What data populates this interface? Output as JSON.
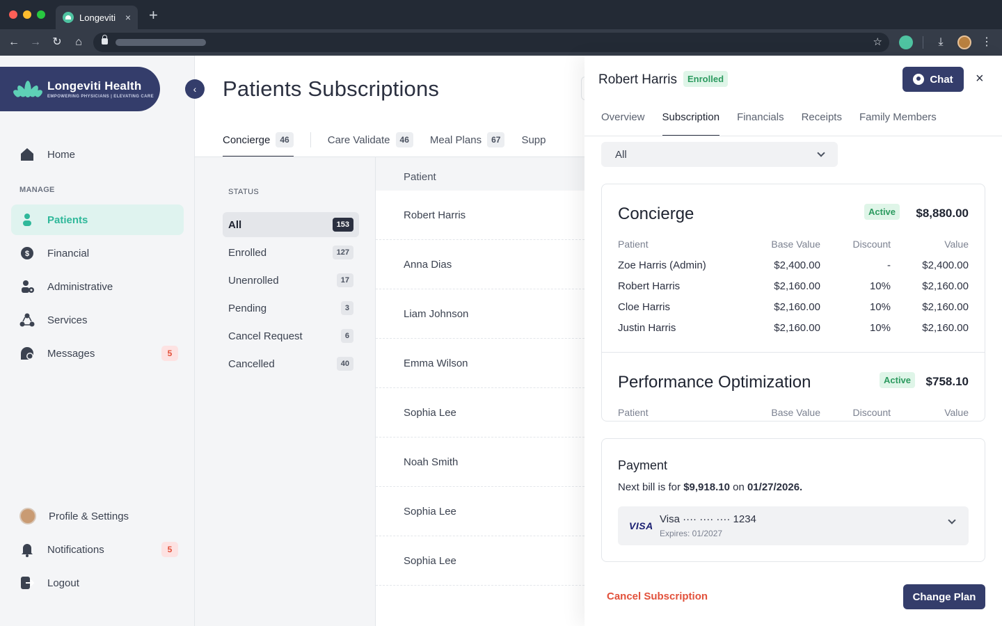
{
  "browser": {
    "tab_title": "Longeviti",
    "tab_close": "×",
    "new_tab": "+"
  },
  "sidebar": {
    "brand_name": "Longeviti Health",
    "brand_tagline": "EMPOWERING PHYSICIANS | ELEVATING CARE",
    "collapse_icon": "‹",
    "home": "Home",
    "section_manage": "MANAGE",
    "items": [
      {
        "label": "Patients",
        "icon": "person-icon"
      },
      {
        "label": "Financial",
        "icon": "dollar-icon"
      },
      {
        "label": "Administrative",
        "icon": "admin-icon"
      },
      {
        "label": "Services",
        "icon": "services-icon"
      },
      {
        "label": "Messages",
        "icon": "messages-icon",
        "badge": "5"
      }
    ],
    "bottom": [
      {
        "label": "Profile & Settings",
        "icon": "avatar"
      },
      {
        "label": "Notifications",
        "icon": "bell-icon",
        "badge": "5"
      },
      {
        "label": "Logout",
        "icon": "logout-icon"
      }
    ]
  },
  "main": {
    "title": "Patients Subscriptions",
    "tabs": [
      {
        "label": "Concierge",
        "count": "46"
      },
      {
        "label": "Care Validate",
        "count": "46"
      },
      {
        "label": "Meal Plans",
        "count": "67"
      },
      {
        "label": "Supp"
      }
    ],
    "status_header": "STATUS",
    "statuses": [
      {
        "label": "All",
        "count": "153"
      },
      {
        "label": "Enrolled",
        "count": "127"
      },
      {
        "label": "Unenrolled",
        "count": "17"
      },
      {
        "label": "Pending",
        "count": "3"
      },
      {
        "label": "Cancel Request",
        "count": "6"
      },
      {
        "label": "Cancelled",
        "count": "40"
      }
    ],
    "patient_header": "Patient",
    "patients": [
      "Robert Harris",
      "Anna Dias",
      "Liam Johnson",
      "Emma Wilson",
      "Sophia Lee",
      "Noah Smith",
      "Sophia Lee",
      "Sophia Lee"
    ]
  },
  "panel": {
    "name": "Robert Harris",
    "status": "Enrolled",
    "chat_label": "Chat",
    "close": "×",
    "tabs": [
      "Overview",
      "Subscription",
      "Financials",
      "Receipts",
      "Family Members"
    ],
    "filter_value": "All",
    "plans": [
      {
        "title": "Concierge",
        "status": "Active",
        "total": "$8,880.00",
        "headers": [
          "Patient",
          "Base Value",
          "Discount",
          "Value"
        ],
        "rows": [
          [
            "Zoe Harris (Admin)",
            "$2,400.00",
            "-",
            "$2,400.00"
          ],
          [
            "Robert Harris",
            "$2,160.00",
            "10%",
            "$2,160.00"
          ],
          [
            "Cloe Harris",
            "$2,160.00",
            "10%",
            "$2,160.00"
          ],
          [
            "Justin Harris",
            "$2,160.00",
            "10%",
            "$2,160.00"
          ]
        ]
      },
      {
        "title": "Performance Optimization",
        "status": "Active",
        "total": "$758.10",
        "headers": [
          "Patient",
          "Base Value",
          "Discount",
          "Value"
        ]
      }
    ],
    "payment": {
      "title": "Payment",
      "text_prefix": "Next bill is for ",
      "amount": "$9,918.10",
      "text_mid": " on ",
      "date": "01/27/2026.",
      "card_brand": "VISA",
      "card_number": "Visa ···· ···· ···· 1234",
      "card_expiry": "Expires: 01/2027"
    },
    "cancel_label": "Cancel Subscription",
    "change_label": "Change Plan"
  }
}
